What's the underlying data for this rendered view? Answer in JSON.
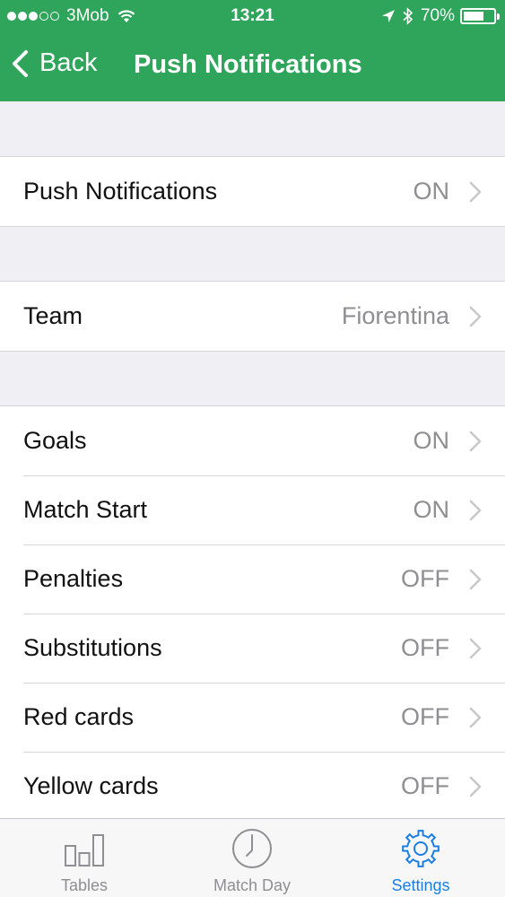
{
  "status_bar": {
    "carrier": "3Mob",
    "time": "13:21",
    "battery": "70%",
    "battery_level": 0.7
  },
  "nav": {
    "back_label": "Back",
    "title": "Push Notifications"
  },
  "groups": {
    "master": [
      {
        "label": "Push Notifications",
        "value": "ON"
      }
    ],
    "team": [
      {
        "label": "Team",
        "value": "Fiorentina"
      }
    ],
    "events": [
      {
        "label": "Goals",
        "value": "ON"
      },
      {
        "label": "Match Start",
        "value": "ON"
      },
      {
        "label": "Penalties",
        "value": "OFF"
      },
      {
        "label": "Substitutions",
        "value": "OFF"
      },
      {
        "label": "Red cards",
        "value": "OFF"
      },
      {
        "label": "Yellow cards",
        "value": "OFF"
      }
    ]
  },
  "tabs": [
    {
      "label": "Tables",
      "icon": "bar-chart-icon",
      "active": false
    },
    {
      "label": "Match Day",
      "icon": "clock-icon",
      "active": false
    },
    {
      "label": "Settings",
      "icon": "gear-icon",
      "active": true
    }
  ],
  "colors": {
    "header": "#2ea55b",
    "active_tab": "#1a7ee3"
  }
}
